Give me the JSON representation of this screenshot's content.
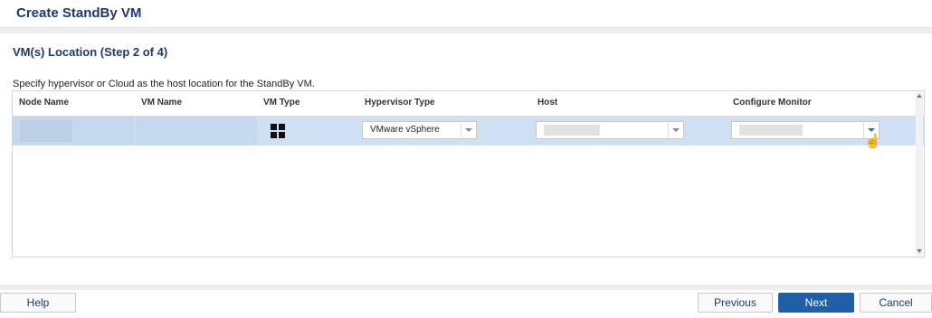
{
  "dialog": {
    "title": "Create StandBy VM"
  },
  "step": {
    "title": "VM(s) Location (Step 2 of 4)",
    "description": "Specify hypervisor or Cloud as the host location for the StandBy VM."
  },
  "table": {
    "headers": [
      "Node Name",
      "VM Name",
      "VM Type",
      "Hypervisor Type",
      "Host",
      "Configure Monitor"
    ],
    "rows": [
      {
        "node_name": "",
        "vm_name": "",
        "vm_type_icon": "windows-icon",
        "hypervisor_type": "VMware vSphere",
        "host": "",
        "configure_monitor": ""
      }
    ]
  },
  "footer": {
    "help": "Help",
    "previous": "Previous",
    "next": "Next",
    "cancel": "Cancel"
  },
  "colors": {
    "title": "#1c3a6e",
    "selected_row": "#cfe0f3",
    "primary_button": "#1f5fa8"
  }
}
